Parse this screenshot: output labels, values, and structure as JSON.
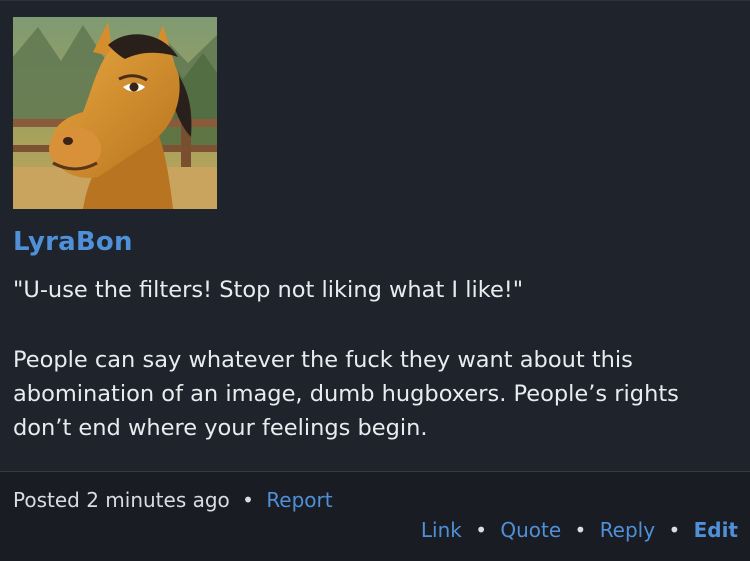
{
  "post": {
    "author": "LyraBon",
    "paragraphs": [
      "\"U-use the filters! Stop not liking what I like!\"",
      "People can say whatever the fuck they want about this abomination of an image, dumb hugboxers. People’s rights don’t end where your feelings begin."
    ]
  },
  "footer": {
    "posted_time": "Posted 2 minutes ago",
    "separator": "•",
    "report_label": "Report",
    "actions": {
      "link": "Link",
      "quote": "Quote",
      "reply": "Reply",
      "edit": "Edit"
    }
  },
  "colors": {
    "background": "#1f232c",
    "footer_background": "#191c23",
    "link": "#4f90d8",
    "text": "#e9ebef"
  },
  "icons": {
    "avatar": "cartoon-horse-avatar"
  }
}
